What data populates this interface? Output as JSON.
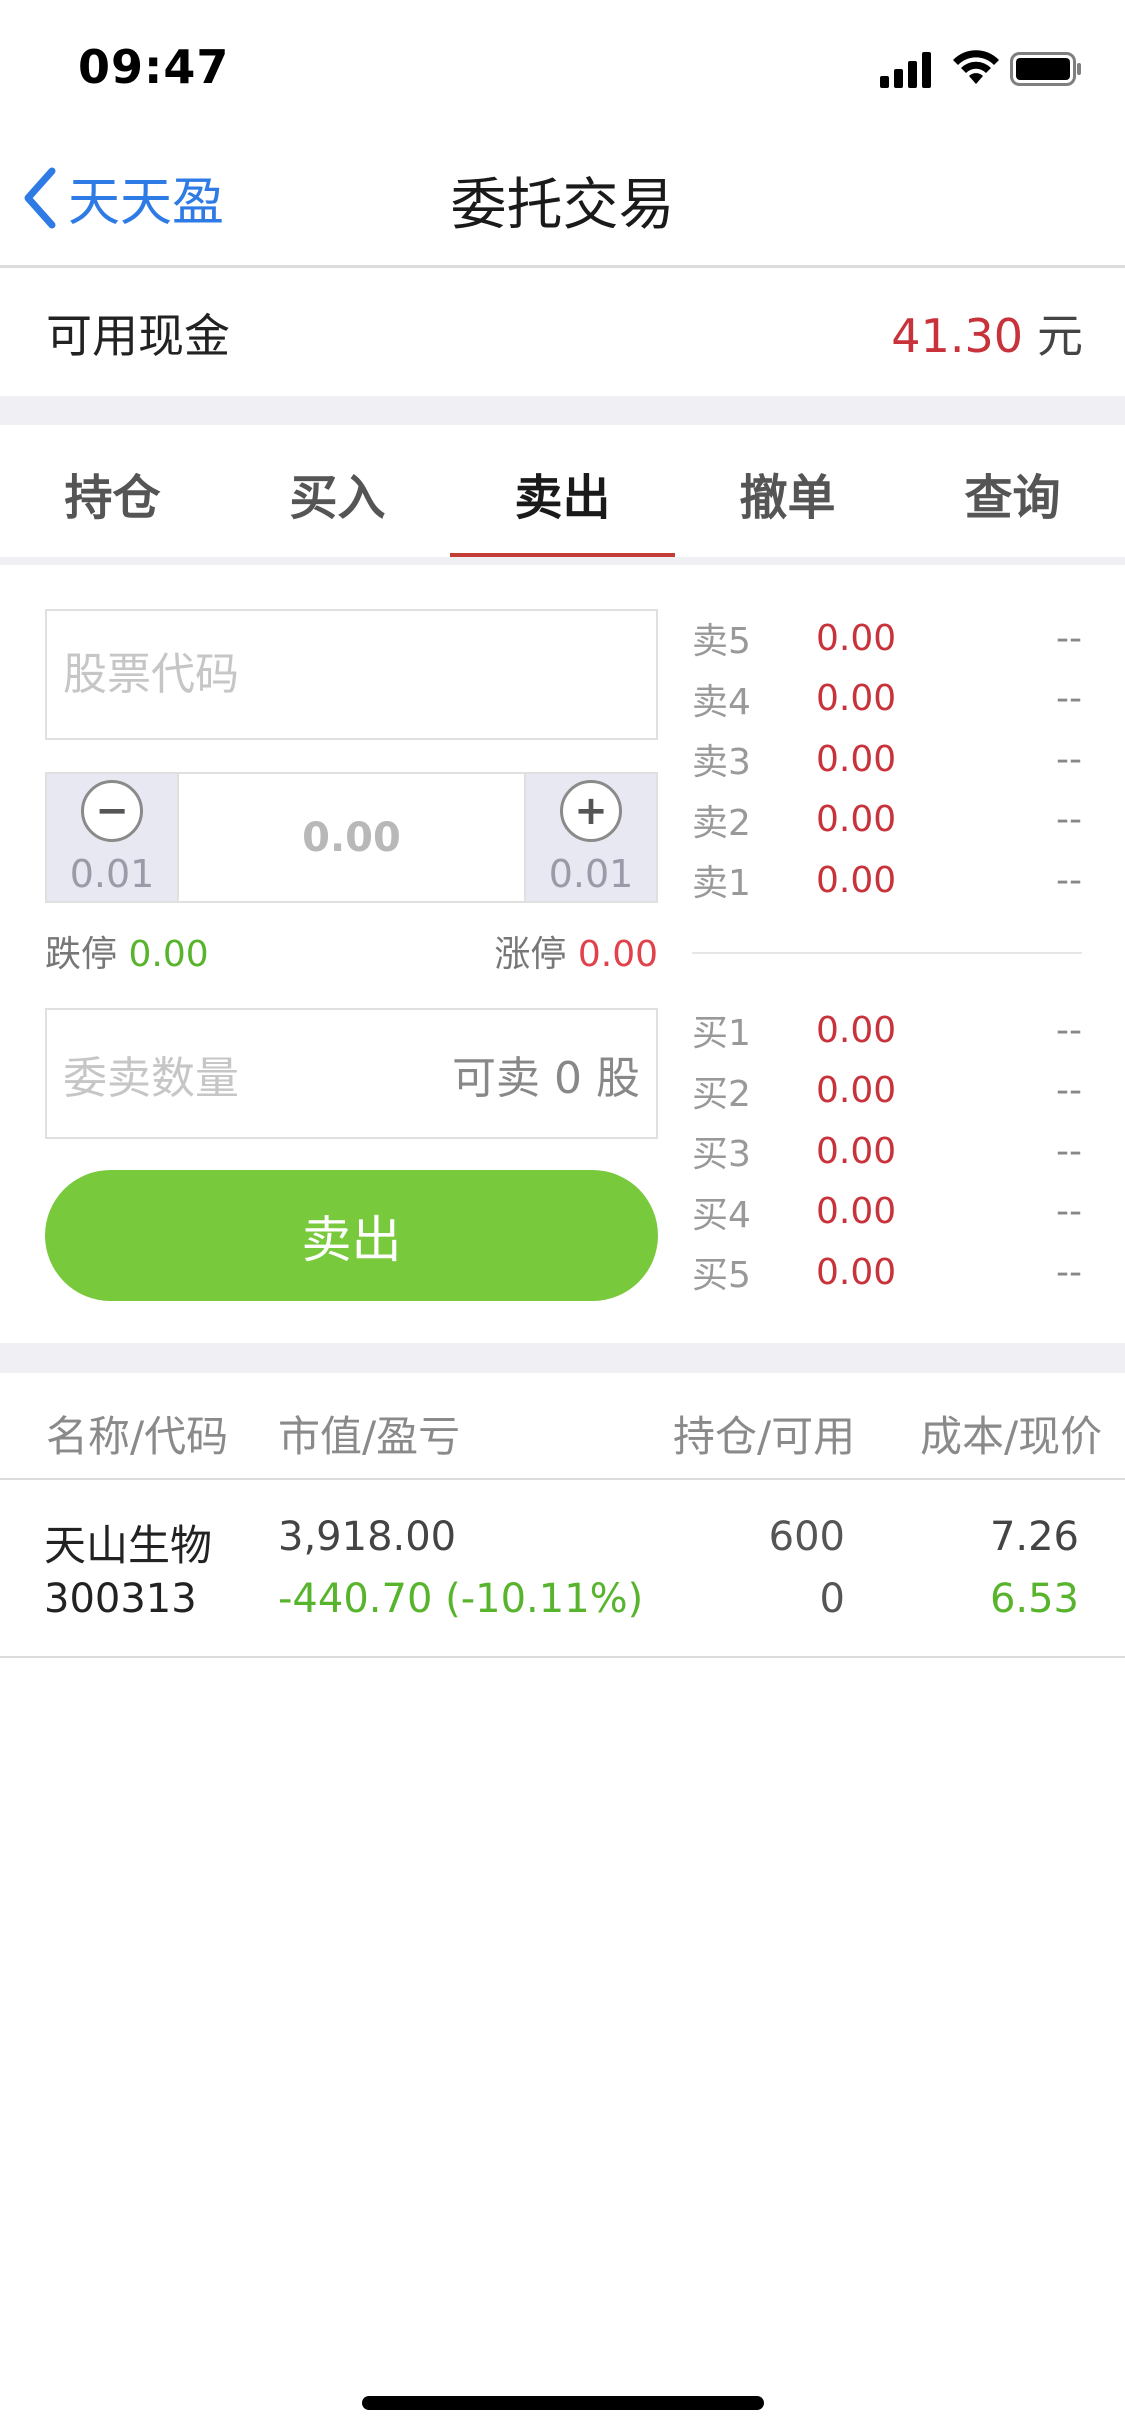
{
  "status_bar": {
    "time": "09:47"
  },
  "nav": {
    "back_label": "天天盈",
    "title": "委托交易"
  },
  "account": {
    "cash_label": "可用现金",
    "cash_value": "41.30",
    "cash_unit": "元"
  },
  "tabs": [
    {
      "label": "持仓",
      "active": false
    },
    {
      "label": "买入",
      "active": false
    },
    {
      "label": "卖出",
      "active": true
    },
    {
      "label": "撤单",
      "active": false
    },
    {
      "label": "查询",
      "active": false
    }
  ],
  "form": {
    "code_placeholder": "股票代码",
    "price_value": "0.00",
    "decrement_step": "0.01",
    "increment_step": "0.01",
    "limit_down_label": "跌停",
    "limit_down_value": "0.00",
    "limit_up_label": "涨停",
    "limit_up_value": "0.00",
    "qty_placeholder": "委卖数量",
    "available_text": "可卖 0 股",
    "submit_label": "卖出"
  },
  "order_book": {
    "asks": [
      {
        "label": "卖5",
        "price": "0.00",
        "volume": "--"
      },
      {
        "label": "卖4",
        "price": "0.00",
        "volume": "--"
      },
      {
        "label": "卖3",
        "price": "0.00",
        "volume": "--"
      },
      {
        "label": "卖2",
        "price": "0.00",
        "volume": "--"
      },
      {
        "label": "卖1",
        "price": "0.00",
        "volume": "--"
      }
    ],
    "bids": [
      {
        "label": "买1",
        "price": "0.00",
        "volume": "--"
      },
      {
        "label": "买2",
        "price": "0.00",
        "volume": "--"
      },
      {
        "label": "买3",
        "price": "0.00",
        "volume": "--"
      },
      {
        "label": "买4",
        "price": "0.00",
        "volume": "--"
      },
      {
        "label": "买5",
        "price": "0.00",
        "volume": "--"
      }
    ]
  },
  "positions": {
    "headers": [
      "名称/代码",
      "市值/盈亏",
      "持仓/可用",
      "成本/现价"
    ],
    "rows": [
      {
        "name": "天山生物",
        "code": "300313",
        "market_value": "3,918.00",
        "pnl": "-440.70 (-10.11%)",
        "holding": "600",
        "available": "0",
        "cost": "7.26",
        "current": "6.53"
      }
    ]
  },
  "colors": {
    "accent_blue": "#2f7be6",
    "price_red": "#c8323a",
    "loss_green": "#59b42d",
    "button_green": "#78c93c",
    "tab_indicator": "#c33c36"
  }
}
